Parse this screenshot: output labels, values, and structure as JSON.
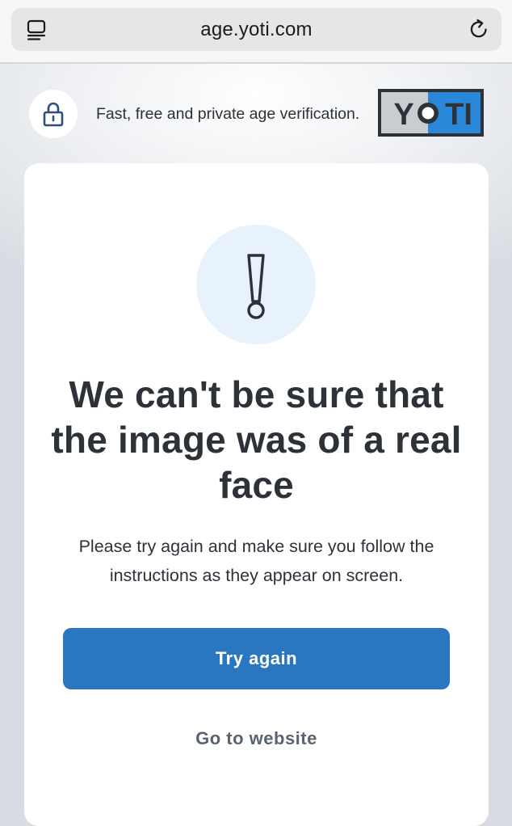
{
  "browser": {
    "url": "age.yoti.com",
    "tabs_icon": "tab-overview-icon",
    "reload_icon": "reload-icon"
  },
  "header": {
    "lock_icon": "lock-icon",
    "tagline": "Fast, free and private age verification.",
    "logo_text": "YOTI"
  },
  "card": {
    "alert_icon": "exclamation-icon",
    "title": "We can't be sure that the image was of a real face",
    "description": "Please try again and make sure you follow the instructions as they appear on screen.",
    "primary_button": "Try again",
    "secondary_link": "Go to website"
  },
  "colors": {
    "primary": "#2b77bf",
    "text_dark": "#2d3238",
    "link_gray": "#5b6370",
    "alert_bg": "#e8f2fd",
    "logo_blue": "#2b87d8"
  }
}
